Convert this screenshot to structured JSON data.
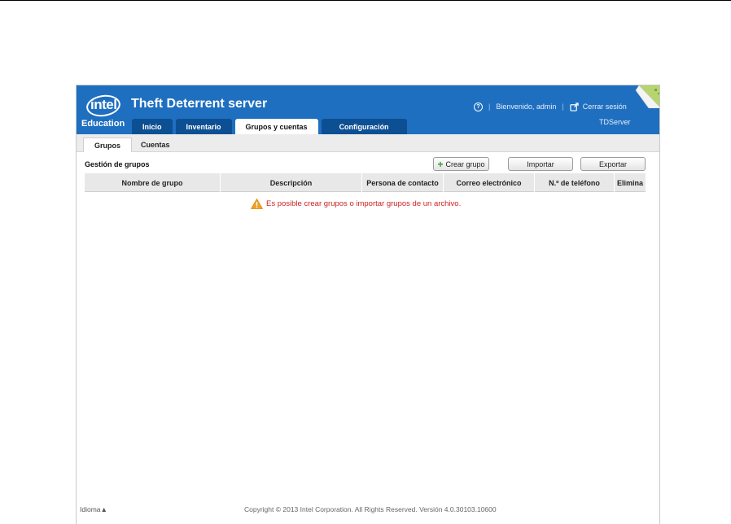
{
  "header": {
    "logo_text": "intel",
    "logo_subtext": "Education",
    "app_title": "Theft Deterrent server",
    "help_icon": "question-circle-icon",
    "welcome": "Bienvenido, admin",
    "logout": "Cerrar sesión",
    "logout_icon": "external-link-icon",
    "server_name": "TDServer",
    "brand_color": "#1f6fc0"
  },
  "nav": {
    "tabs": [
      {
        "label": "Inicio"
      },
      {
        "label": "Inventario"
      },
      {
        "label": "Grupos y cuentas"
      },
      {
        "label": "Configuración"
      }
    ],
    "active_tab": "Grupos y cuentas"
  },
  "subtabs": {
    "items": [
      {
        "label": "Grupos"
      },
      {
        "label": "Cuentas"
      }
    ],
    "active": "Grupos"
  },
  "main": {
    "section_title": "Gestión de grupos",
    "buttons": {
      "create": "Crear grupo",
      "import": "Importar",
      "export": "Exportar"
    },
    "table": {
      "columns": [
        "Nombre de grupo",
        "Descripción",
        "Persona de contacto",
        "Correo electrónico",
        "N.º de teléfono",
        "Elimina"
      ],
      "rows": []
    },
    "notice": "Es posible crear grupos o importar grupos de un archivo.",
    "notice_icon": "warning-icon",
    "notice_color": "#cc2222"
  },
  "footer": {
    "language": "Idioma▲",
    "copyright": "Copyright © 2013 Intel Corporation. All Rights Reserved. Versión 4.0.30103.10600"
  }
}
